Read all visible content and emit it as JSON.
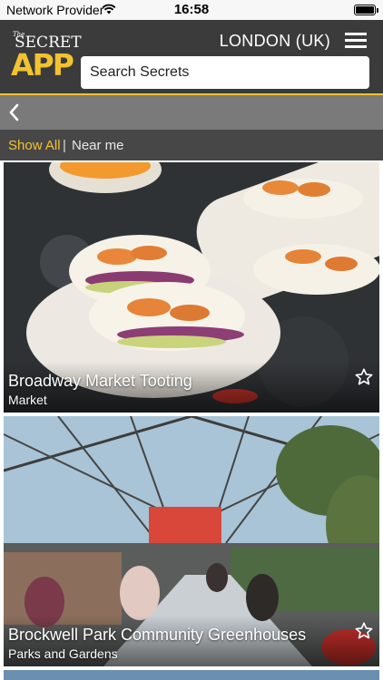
{
  "status_bar": {
    "carrier": "Network Provider",
    "time": "16:58",
    "battery_level": 1.0
  },
  "header": {
    "logo": {
      "small_text": "The",
      "top_text": "SECRET",
      "main_text": "APP"
    },
    "city": "LONDON (UK)",
    "search_placeholder": "Search Secrets",
    "menu_icon": "hamburger-menu-icon"
  },
  "nav": {
    "back_icon": "chevron-left-icon"
  },
  "filters": {
    "show_all": "Show All",
    "separator": "|",
    "near_me": "Near me",
    "active": "Show All"
  },
  "cards": [
    {
      "title": "Broadway Market Tooting",
      "category": "Market",
      "favorite_icon": "star-outline-icon"
    },
    {
      "title": "Brockwell Park Community Greenhouses",
      "category": "Parks and Gardens",
      "favorite_icon": "star-outline-icon"
    }
  ],
  "colors": {
    "accent": "#f2c230",
    "header_bg": "#3b3b3b",
    "back_bar_bg": "#7a7a7a",
    "filter_bar_bg": "#474747"
  }
}
